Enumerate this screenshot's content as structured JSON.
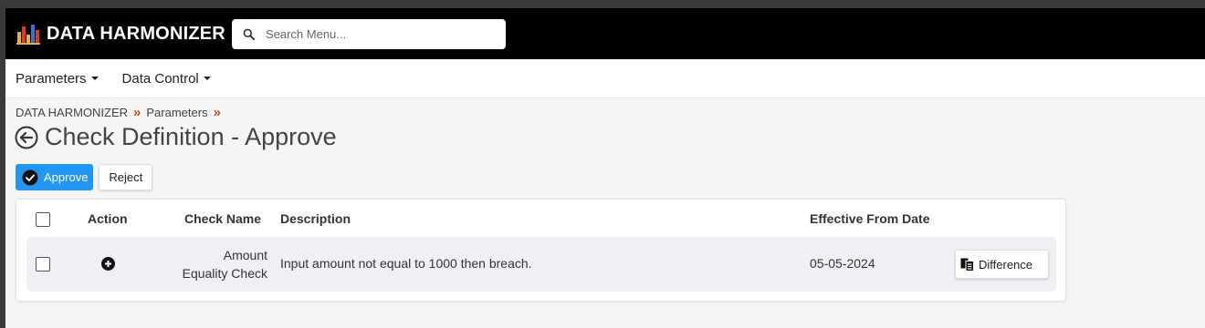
{
  "app": {
    "brand": "DATA HARMONIZER"
  },
  "search": {
    "placeholder": "Search Menu...",
    "icon": "search-icon"
  },
  "menu": {
    "items": [
      {
        "label": "Parameters"
      },
      {
        "label": "Data Control"
      }
    ]
  },
  "breadcrumb": {
    "items": [
      "DATA HARMONIZER",
      "Parameters"
    ],
    "separator": "»"
  },
  "page": {
    "title": "Check Definition - Approve"
  },
  "actions": {
    "approve_label": "Approve",
    "reject_label": "Reject",
    "accent": "#2196f3"
  },
  "table": {
    "columns": [
      "Action",
      "Check Name",
      "Description",
      "Effective From Date"
    ],
    "rows": [
      {
        "check_name_line1": "Amount",
        "check_name_line2": "Equality Check",
        "description": "Input amount not equal to 1000 then breach.",
        "effective_from": "05-05-2024",
        "difference_label": "Difference"
      }
    ]
  }
}
